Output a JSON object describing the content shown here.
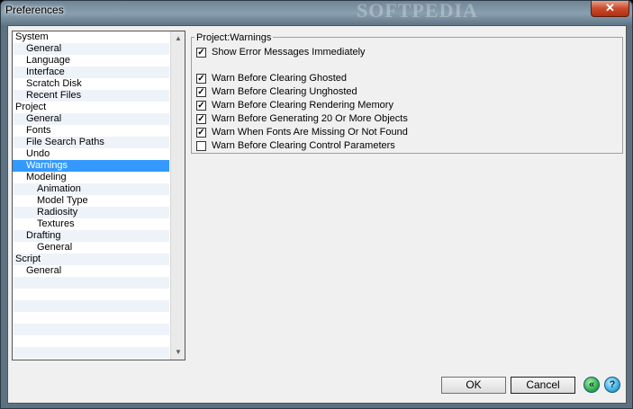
{
  "window": {
    "title": "Preferences",
    "watermark": "SOFTPEDIA",
    "close_glyph": "✕"
  },
  "tree": {
    "items": [
      {
        "label": "System",
        "level": 0
      },
      {
        "label": "General",
        "level": 1
      },
      {
        "label": "Language",
        "level": 1
      },
      {
        "label": "Interface",
        "level": 1
      },
      {
        "label": "Scratch Disk",
        "level": 1
      },
      {
        "label": "Recent Files",
        "level": 1
      },
      {
        "label": "Project",
        "level": 0
      },
      {
        "label": "General",
        "level": 1
      },
      {
        "label": "Fonts",
        "level": 1
      },
      {
        "label": "File Search Paths",
        "level": 1
      },
      {
        "label": "Undo",
        "level": 1
      },
      {
        "label": "Warnings",
        "level": 1,
        "selected": true
      },
      {
        "label": "Modeling",
        "level": 1
      },
      {
        "label": "Animation",
        "level": 2
      },
      {
        "label": "Model Type",
        "level": 2
      },
      {
        "label": "Radiosity",
        "level": 2
      },
      {
        "label": "Textures",
        "level": 2
      },
      {
        "label": "Drafting",
        "level": 1
      },
      {
        "label": "General",
        "level": 2
      },
      {
        "label": "Script",
        "level": 0
      },
      {
        "label": "General",
        "level": 1
      }
    ],
    "selected_color": "#3399ff"
  },
  "warnings": {
    "group_title": "Project:Warnings",
    "options": [
      {
        "label": "Show Error Messages Immediately",
        "checked": true
      },
      {
        "label": "Warn Before Clearing Ghosted",
        "checked": true
      },
      {
        "label": "Warn Before Clearing Unghosted",
        "checked": true
      },
      {
        "label": "Warn Before Clearing Rendering Memory",
        "checked": true
      },
      {
        "label": "Warn Before Generating 20 Or More Objects",
        "checked": true
      },
      {
        "label": "Warn When Fonts Are Missing Or Not Found",
        "checked": true
      },
      {
        "label": "Warn Before Clearing Control Parameters",
        "checked": false
      }
    ]
  },
  "buttons": {
    "ok": "OK",
    "cancel": "Cancel",
    "back_icon_glyph": "«",
    "help_icon_glyph": "?"
  }
}
